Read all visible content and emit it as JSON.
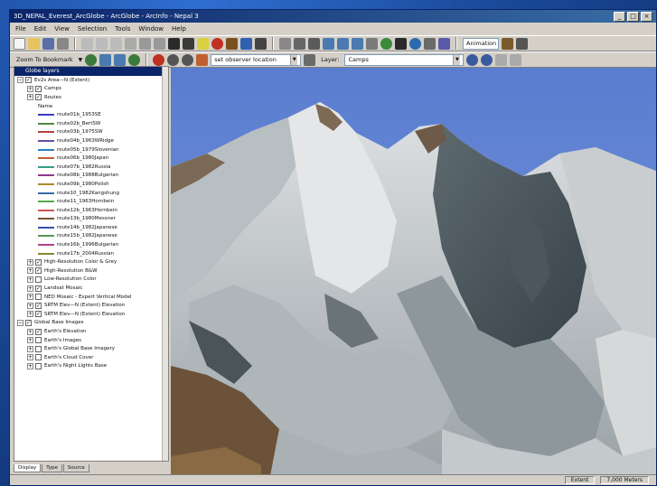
{
  "window": {
    "title": "3D_NEPAL_Everest_ArcGlobe - ArcGlobe - ArcInfo - Nepal 3",
    "buttons": {
      "minimize": "_",
      "maximize": "□",
      "close": "×"
    }
  },
  "menu": [
    "File",
    "Edit",
    "View",
    "Selection",
    "Tools",
    "Window",
    "Help"
  ],
  "toolbar2": {
    "zoom_to_bookmark": "Zoom To Bookmark",
    "location_combo": "set observer location",
    "layer_label": "Layer:",
    "layer_value": "Camps",
    "animation_label": "Animation"
  },
  "toc": {
    "header": "Globe layers",
    "root": "Ev2s Area—N (Extent)",
    "items": [
      {
        "label": "Camps",
        "check": true,
        "type": "layer"
      },
      {
        "label": "Routes",
        "check": true,
        "type": "layer"
      },
      {
        "label": "Name",
        "type": "legend-head"
      },
      {
        "label": "route01b_1953SE",
        "color": "#3a3acc",
        "type": "legend"
      },
      {
        "label": "route02b_BertSW",
        "color": "#4a8a3a",
        "type": "legend"
      },
      {
        "label": "route03b_1975SW",
        "color": "#b04040",
        "type": "legend"
      },
      {
        "label": "route04b_1963WRidge",
        "color": "#6a4aa8",
        "type": "legend"
      },
      {
        "label": "route05b_1979Slovenian",
        "color": "#2f7fbf",
        "type": "legend"
      },
      {
        "label": "route06b_1980Japan",
        "color": "#c06030",
        "type": "legend"
      },
      {
        "label": "route07b_1982Russia",
        "color": "#3a9a8a",
        "type": "legend"
      },
      {
        "label": "route08b_1988Bulgarian",
        "color": "#8a3a8a",
        "type": "legend"
      },
      {
        "label": "route09b_1980Polish",
        "color": "#aa8a2a",
        "type": "legend"
      },
      {
        "label": "route10_1982Kangshung",
        "color": "#3a6aaa",
        "type": "legend"
      },
      {
        "label": "route11_1963Hornbein",
        "color": "#5aaa4a",
        "type": "legend"
      },
      {
        "label": "route12b_1963Hornbein",
        "color": "#cc5555",
        "type": "legend"
      },
      {
        "label": "route13b_1980Messner",
        "color": "#775533",
        "type": "legend"
      },
      {
        "label": "route14b_1982Japanese",
        "color": "#3355aa",
        "type": "legend"
      },
      {
        "label": "route15b_1982Japanese",
        "color": "#559955",
        "type": "legend"
      },
      {
        "label": "route16b_1996Bulgarian",
        "color": "#aa4488",
        "type": "legend"
      },
      {
        "label": "route17b_2004Russian",
        "color": "#888833",
        "type": "legend"
      },
      {
        "label": "High-Resolution Color & Grey",
        "check": true,
        "type": "layer"
      },
      {
        "label": "High-Resolution B&W",
        "check": true,
        "type": "layer"
      },
      {
        "label": "Low-Resolution Color",
        "check": false,
        "type": "layer"
      },
      {
        "label": "Landsat Mosaic",
        "check": true,
        "type": "layer"
      },
      {
        "label": "NED Mosaic - Expert Vertical Model",
        "check": false,
        "type": "layer"
      },
      {
        "label": "SRTM Elev—N (Extent) Elevation",
        "check": true,
        "type": "layer"
      },
      {
        "label": "SRTM Elev—N (Extent) Elevation",
        "check": true,
        "type": "layer"
      }
    ],
    "group2": "Global Base Images",
    "items2": [
      {
        "label": "Earth's Elevation",
        "check": true
      },
      {
        "label": "Earth's Images",
        "check": false
      },
      {
        "label": "Earth's Global Base Imagery",
        "check": false
      },
      {
        "label": "Earth's Cloud Cover",
        "check": false
      },
      {
        "label": "Earth's Night Lights Base",
        "check": false
      }
    ],
    "tabs": [
      "Display",
      "Type",
      "Source"
    ]
  },
  "status": {
    "extent": "Extent",
    "units": "7,000 Meters"
  },
  "colors": {
    "accent": "#0a246a",
    "sky": "#5e7fcf"
  }
}
